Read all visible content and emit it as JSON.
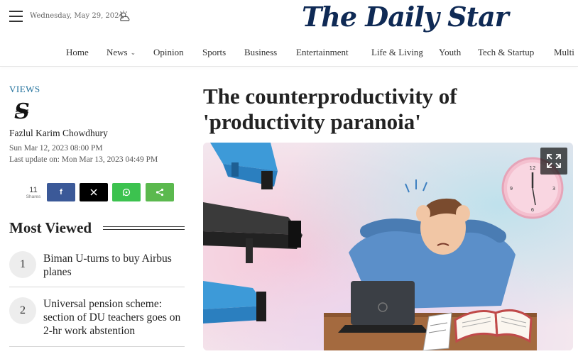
{
  "header": {
    "date": "Wednesday, May 29, 2024",
    "weather_icon": "partly-cloudy-icon",
    "logo_text": "The Daily Star",
    "brand_color": "#0f2a55"
  },
  "nav": {
    "items": [
      {
        "label": "Home"
      },
      {
        "label": "News"
      },
      {
        "label": "Opinion"
      },
      {
        "label": "Sports"
      },
      {
        "label": "Business"
      },
      {
        "label": "Entertainment"
      },
      {
        "label": "Life & Living"
      },
      {
        "label": "Youth"
      },
      {
        "label": "Tech & Startup"
      },
      {
        "label": "Multi"
      }
    ]
  },
  "article": {
    "section": "VIEWS",
    "author": "Fazlul Karim Chowdhury",
    "author_avatar_icon": "daily-star-monogram-icon",
    "published": "Sun Mar 12, 2023 08:00 PM",
    "updated": "Last update on: Mon Mar 13, 2023 04:49 PM",
    "headline": "The counterproductivity of 'productivity paranoia'",
    "hero_alt": "Illustration of a stressed worker surrounded by surveillance cameras and a clock"
  },
  "share": {
    "count": "11",
    "count_label": "Shares",
    "buttons": [
      {
        "name": "facebook",
        "glyph": "f",
        "color": "#3b5998"
      },
      {
        "name": "x",
        "glyph": "𝕏",
        "color": "#000000"
      },
      {
        "name": "whatsapp",
        "glyph": "✆",
        "color": "#3cc24f"
      },
      {
        "name": "sharethis",
        "glyph": "<",
        "color": "#5bb94e"
      }
    ]
  },
  "most_viewed": {
    "title": "Most Viewed",
    "items": [
      {
        "rank": "1",
        "title": "Biman U-turns to buy Airbus planes"
      },
      {
        "rank": "2",
        "title": "Universal pension scheme: section of DU teachers goes on 2-hr work abstention"
      }
    ]
  }
}
